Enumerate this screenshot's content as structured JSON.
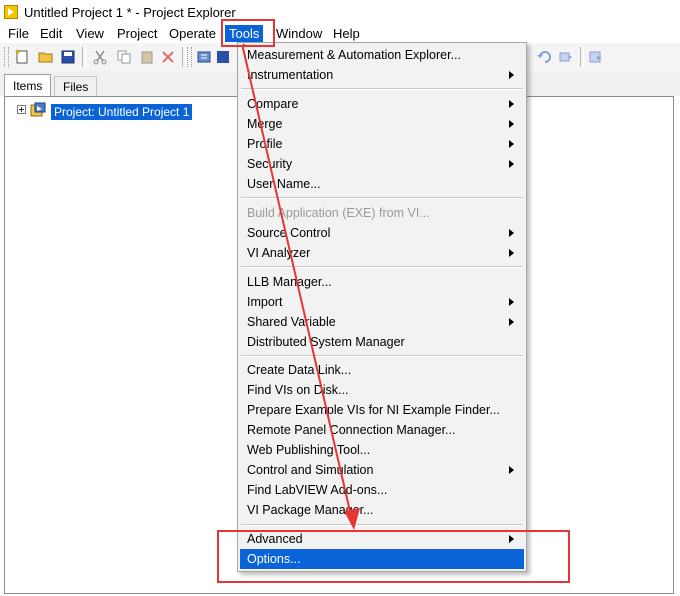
{
  "window": {
    "title": "Untitled Project 1 * - Project Explorer"
  },
  "menubar": [
    {
      "label": "File"
    },
    {
      "label": "Edit"
    },
    {
      "label": "View"
    },
    {
      "label": "Project"
    },
    {
      "label": "Operate"
    },
    {
      "label": "Tools"
    },
    {
      "label": "Window"
    },
    {
      "label": "Help"
    }
  ],
  "tabs": [
    {
      "label": "Items"
    },
    {
      "label": "Files"
    }
  ],
  "tree": {
    "project_label": "Project: Untitled Project 1"
  },
  "tools_menu": {
    "items": [
      {
        "label": "Measurement & Automation Explorer..."
      },
      {
        "label": "Instrumentation"
      },
      {
        "label": "Compare"
      },
      {
        "label": "Merge"
      },
      {
        "label": "Profile"
      },
      {
        "label": "Security"
      },
      {
        "label": "User Name..."
      },
      {
        "label": "Build Application (EXE) from VI..."
      },
      {
        "label": "Source Control"
      },
      {
        "label": "VI Analyzer"
      },
      {
        "label": "LLB Manager..."
      },
      {
        "label": "Import"
      },
      {
        "label": "Shared Variable"
      },
      {
        "label": "Distributed System Manager"
      },
      {
        "label": "Create Data Link..."
      },
      {
        "label": "Find VIs on Disk..."
      },
      {
        "label": "Prepare Example VIs for NI Example Finder..."
      },
      {
        "label": "Remote Panel Connection Manager..."
      },
      {
        "label": "Web Publishing Tool..."
      },
      {
        "label": "Control and Simulation"
      },
      {
        "label": "Find LabVIEW Add-ons..."
      },
      {
        "label": "VI Package Manager..."
      },
      {
        "label": "Advanced"
      },
      {
        "label": "Options..."
      }
    ]
  },
  "colors": {
    "highlight": "#0a64d8",
    "annotation_red": "#e53535",
    "menu_bg": "#f2f2f2"
  },
  "icons": [
    "labview-app-icon",
    "new-icon",
    "open-icon",
    "save-all-icon",
    "cut-icon",
    "copy-icon",
    "paste-icon",
    "delete-icon",
    "build-icon",
    "undo-icon",
    "redo-icon",
    "deploy-icon",
    "project-icon"
  ]
}
